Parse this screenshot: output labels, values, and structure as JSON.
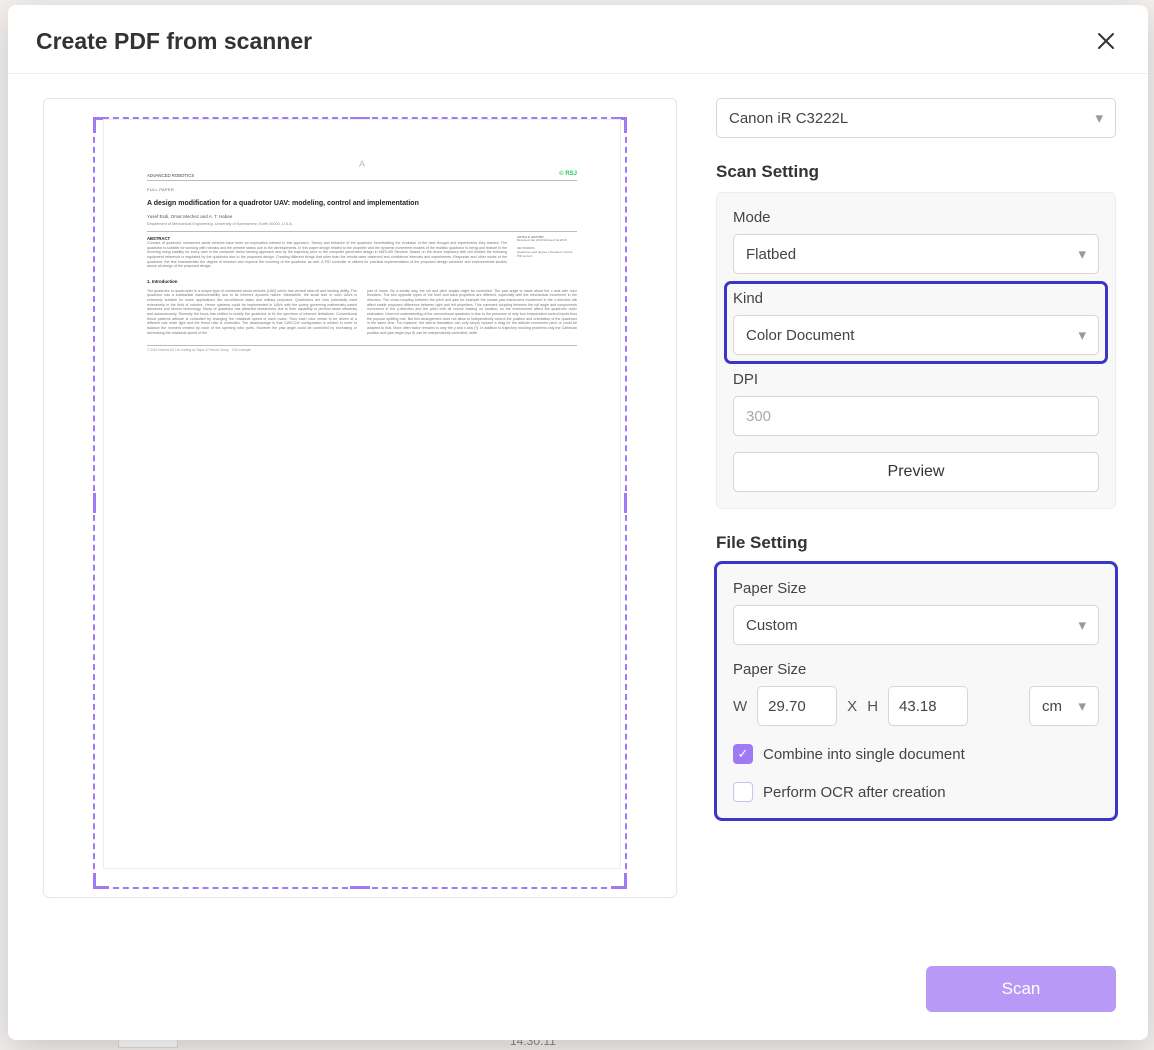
{
  "header": {
    "title": "Create PDF from scanner"
  },
  "scanner": {
    "selected": "Canon iR C3222L"
  },
  "scan_setting": {
    "title": "Scan Setting",
    "mode": {
      "label": "Mode",
      "value": "Flatbed"
    },
    "kind": {
      "label": "Kind",
      "value": "Color Document"
    },
    "dpi": {
      "label": "DPI",
      "value": "300"
    },
    "preview_btn": "Preview"
  },
  "file_setting": {
    "title": "File Setting",
    "paper_size_sel": {
      "label": "Paper Size",
      "value": "Custom"
    },
    "paper_size_dim": {
      "label": "Paper Size",
      "w_label": "W",
      "w": "29.70",
      "x_label": "X",
      "h_label": "H",
      "h": "43.18",
      "unit": "cm"
    },
    "combine": {
      "label": "Combine into single document",
      "checked": true
    },
    "ocr": {
      "label": "Perform OCR after creation",
      "checked": false
    }
  },
  "footer": {
    "scan": "Scan"
  },
  "doc_preview": {
    "journal_left": "ADVANCED ROBOTICS",
    "logo": "© RSJ",
    "fullpaper": "FULL PAPER",
    "title": "A design modification for a quadrotor UAV: modeling, control and implementation",
    "authors": "Yusef Esdi, Omar Mechez and A. T. Habee",
    "affiliation": "Department of Mechanical Engineering, University of Somewhere, Earth 00000, U.S.A.",
    "abstract_h": "ABSTRACT",
    "history_h": "ARTICLE HISTORY",
    "section1_h": "1. Introduction"
  },
  "background": {
    "time": "14:30:11"
  }
}
